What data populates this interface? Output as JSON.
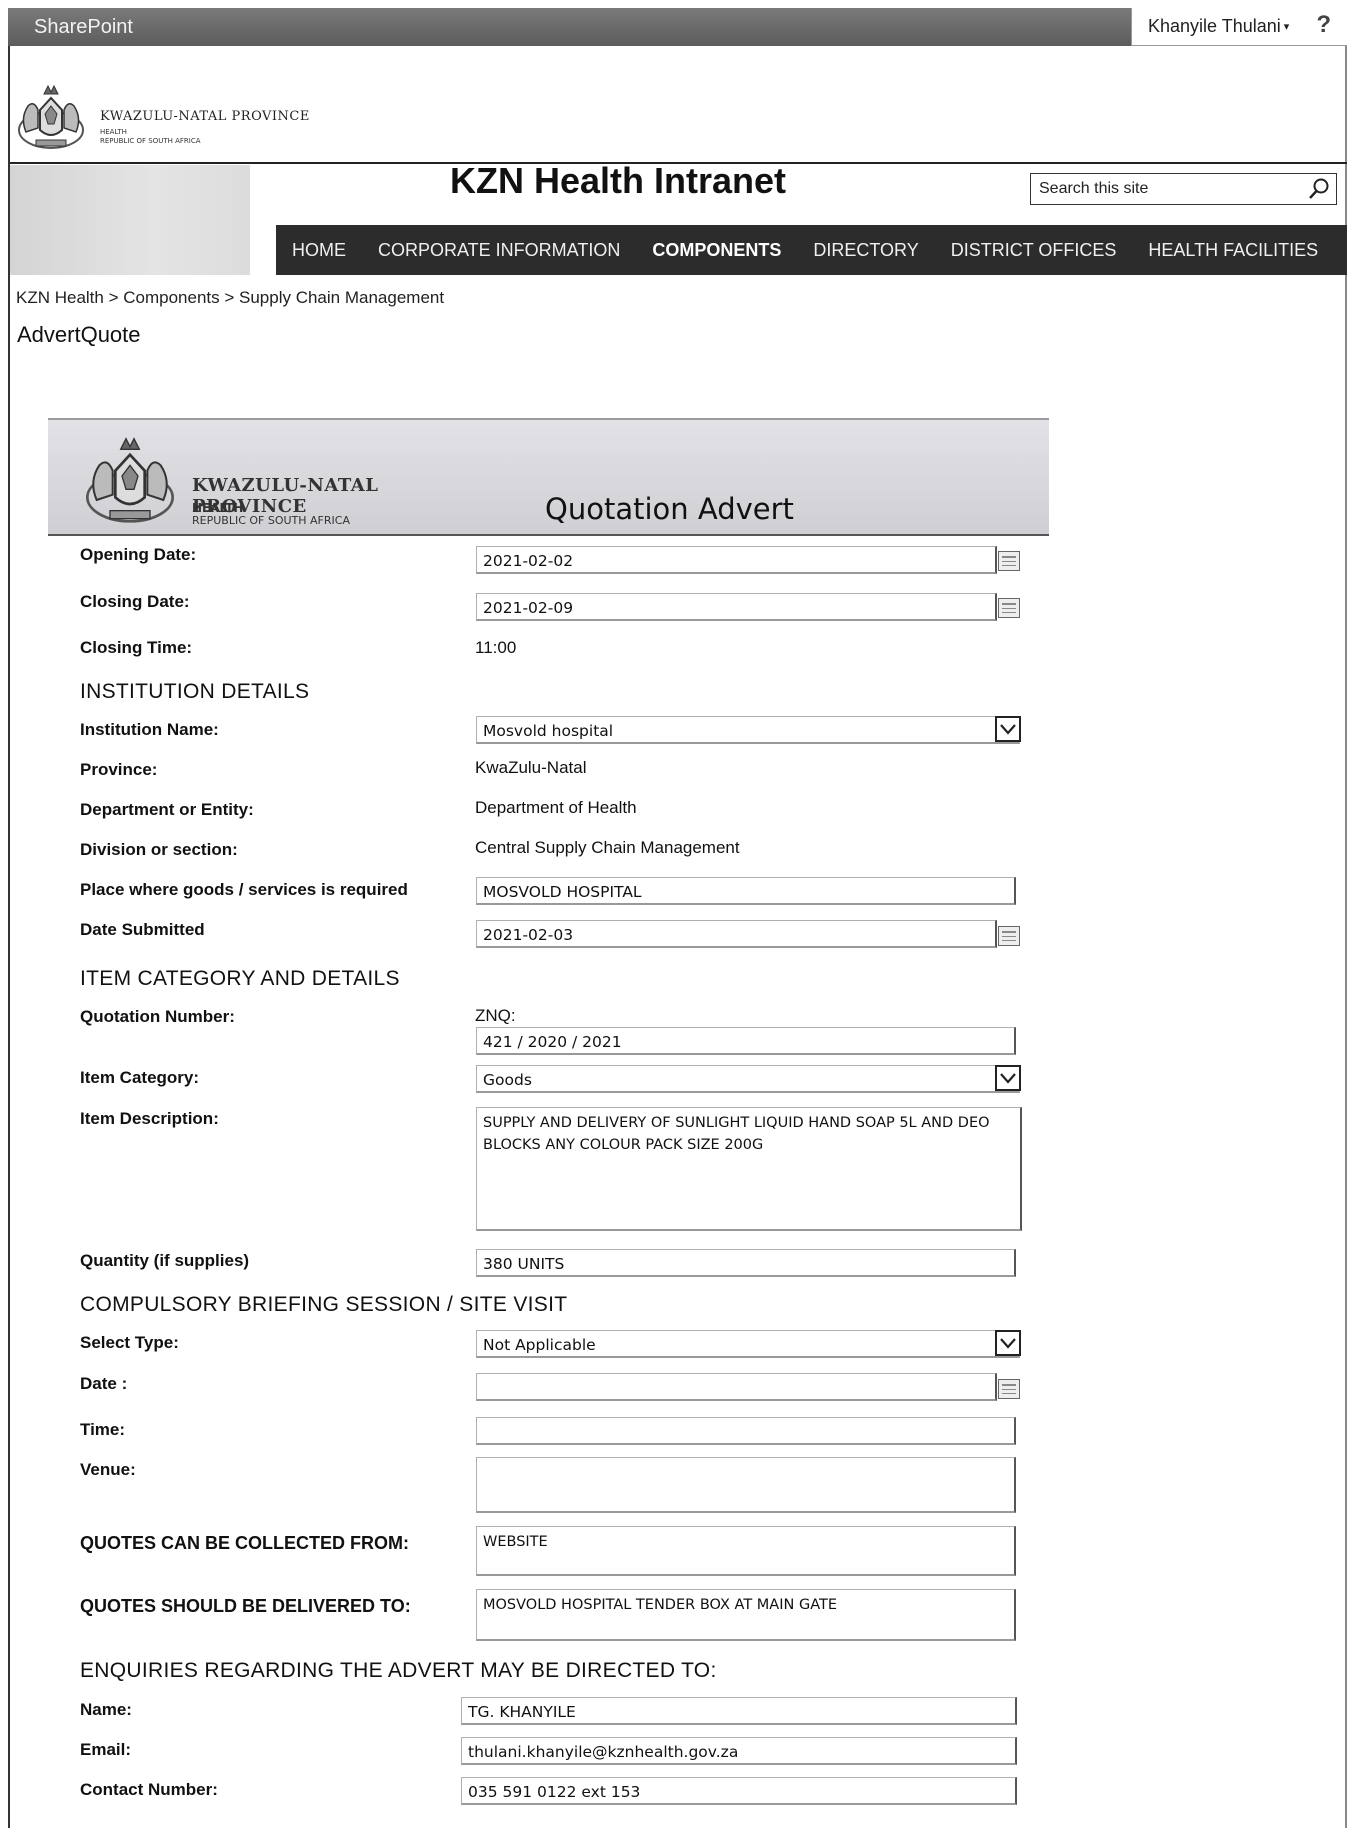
{
  "suitebar": {
    "brand": "SharePoint",
    "user": "Khanyile Thulani",
    "user_caret": "▾",
    "help": "?"
  },
  "header": {
    "logo_main": "KWAZULU-NATAL PROVINCE",
    "logo_sub1": "HEALTH",
    "logo_sub2": "REPUBLIC OF SOUTH AFRICA",
    "site_title": "KZN Health Intranet",
    "search_placeholder": "Search this site"
  },
  "nav": {
    "items": [
      "HOME",
      "CORPORATE INFORMATION",
      "COMPONENTS",
      "DIRECTORY",
      "DISTRICT OFFICES",
      "HEALTH FACILITIES"
    ],
    "active": "COMPONENTS"
  },
  "breadcrumb": "KZN Health > Components > Supply Chain Management",
  "page_title": "AdvertQuote",
  "banner": {
    "logo_main": "KWAZULU-NATAL PROVINCE",
    "logo_sub1": "HEALTH",
    "logo_sub2": "REPUBLIC OF SOUTH AFRICA",
    "title": "Quotation Advert"
  },
  "form": {
    "opening_date": {
      "label": "Opening Date:",
      "value": "2021-02-02"
    },
    "closing_date": {
      "label": "Closing Date:",
      "value": "2021-02-09"
    },
    "closing_time": {
      "label": "Closing Time:",
      "value": "11:00"
    },
    "section_institution": "INSTITUTION DETAILS",
    "institution_name": {
      "label": "Institution Name:",
      "value": "Mosvold hospital"
    },
    "province": {
      "label": "Province:",
      "value": "KwaZulu-Natal"
    },
    "department": {
      "label": "Department or Entity:",
      "value": "Department of Health"
    },
    "division": {
      "label": "Division or section:",
      "value": "Central Supply Chain Management"
    },
    "place": {
      "label": "Place where goods /  services is required",
      "value": "MOSVOLD HOSPITAL"
    },
    "date_submitted": {
      "label": "Date Submitted",
      "value": "2021-02-03"
    },
    "section_item": "ITEM CATEGORY AND DETAILS",
    "quotation_number": {
      "label": "Quotation Number:",
      "prefix": "ZNQ:",
      "value": "421 / 2020 / 2021"
    },
    "item_category": {
      "label": "Item Category:",
      "value": "Goods"
    },
    "item_description": {
      "label": "Item Description:",
      "value": "SUPPLY AND DELIVERY OF SUNLIGHT LIQUID HAND SOAP 5L AND DEO BLOCKS ANY COLOUR PACK SIZE 200G"
    },
    "quantity": {
      "label": "Quantity (if supplies)",
      "value": "380 UNITS"
    },
    "section_briefing": "COMPULSORY BRIEFING SESSION / SITE VISIT",
    "select_type": {
      "label": "Select Type:",
      "value": "Not Applicable"
    },
    "briefing_date": {
      "label": "Date :",
      "value": ""
    },
    "briefing_time": {
      "label": "Time:",
      "value": ""
    },
    "venue": {
      "label": "Venue:",
      "value": ""
    },
    "collected_from": {
      "label": "QUOTES CAN BE COLLECTED FROM:",
      "value": "WEBSITE"
    },
    "delivered_to": {
      "label": "QUOTES SHOULD BE DELIVERED TO:",
      "value": "MOSVOLD HOSPITAL TENDER BOX AT MAIN GATE"
    },
    "section_enquiries": "ENQUIRIES REGARDING THE ADVERT MAY BE DIRECTED TO:",
    "contact_name": {
      "label": "Name:",
      "value": "TG. KHANYILE"
    },
    "contact_email": {
      "label": "Email:",
      "value": "thulani.khanyile@kznhealth.gov.za"
    },
    "contact_number": {
      "label": "Contact Number:",
      "value": "035 591 0122 ext 153"
    }
  },
  "colors": {
    "suitebar": "#666666",
    "nav_bg": "#2c2c2c",
    "banner_bg": "#d8d8dc"
  }
}
